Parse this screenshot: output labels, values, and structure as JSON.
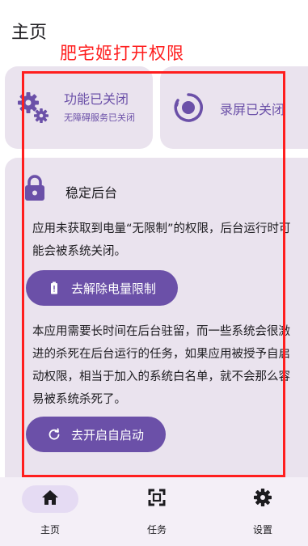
{
  "header": {
    "title": "主页"
  },
  "annotation": {
    "text": "肥宅姬打开权限"
  },
  "feature_card": {
    "title": "功能已关闭",
    "subtitle": "无障碍服务已关闭"
  },
  "record_card": {
    "title": "录屏已关闭"
  },
  "background_card": {
    "title": "稳定后台",
    "paragraph1": "应用未获取到电量“无限制”的权限，后台运行时可能会被系统关闭。",
    "button1": "去解除电量限制",
    "paragraph2": "本应用需要长时间在后台驻留，而一些系统会很激进的杀死在后台运行的任务，如果应用被授予自启动权限，相当于加入的系统白名单，就不会那么容易被系统杀死了。",
    "button2": "去开启自启动"
  },
  "nav": {
    "home": "主页",
    "tasks": "任务",
    "settings": "设置"
  },
  "colors": {
    "accent": "#6b50a8",
    "card": "#eae3ee",
    "annotation": "#ff1e1e"
  }
}
